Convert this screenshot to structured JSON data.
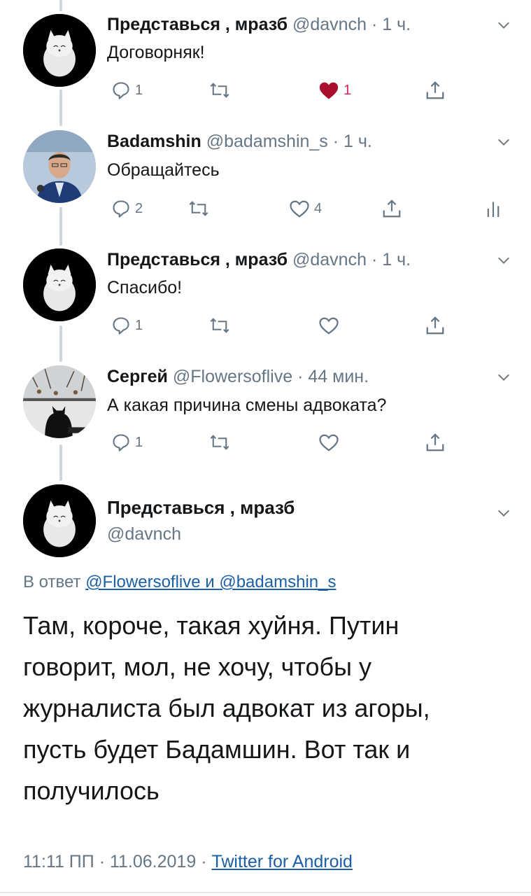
{
  "tweets": [
    {
      "name": "Представься , мразб",
      "handle": "@davnch",
      "time": "1 ч.",
      "text": "Договорняк!",
      "replies": "1",
      "likes": "1",
      "liked": true
    },
    {
      "name": "Badamshin",
      "handle": "@badamshin_s",
      "time": "1 ч.",
      "text": "Обращайтесь",
      "replies": "2",
      "likes": "4",
      "liked": false
    },
    {
      "name": "Представься , мразб",
      "handle": "@davnch",
      "time": "1 ч.",
      "text": "Спасибо!",
      "replies": "1",
      "likes": "",
      "liked": false
    },
    {
      "name": "Сергей",
      "handle": "@Flowersoflive",
      "time": "44 мин.",
      "text": "А какая причина смены адвоката?",
      "replies": "1",
      "likes": "",
      "liked": false
    }
  ],
  "separator": "·",
  "main": {
    "name": "Представься , мразб",
    "handle": "@davnch",
    "reply_prefix": "В ответ",
    "reply_to_1": "@Flowersoflive",
    "reply_and": "и",
    "reply_to_2": "@badamshin_s",
    "lines": [
      "Там, короче, такая хуйня. Путин",
      "говорит, мол, не хочу, чтобы у",
      "журналиста был адвокат из агоры,",
      "пусть будет Бадамшин. Вот так и",
      "получилось"
    ],
    "time": "11:11 ПП",
    "date": "11.06.2019",
    "source": "Twitter for Android"
  },
  "colors": {
    "accent_like": "#e0245e",
    "link": "#1b5fa8",
    "secondary_text": "#657786"
  }
}
